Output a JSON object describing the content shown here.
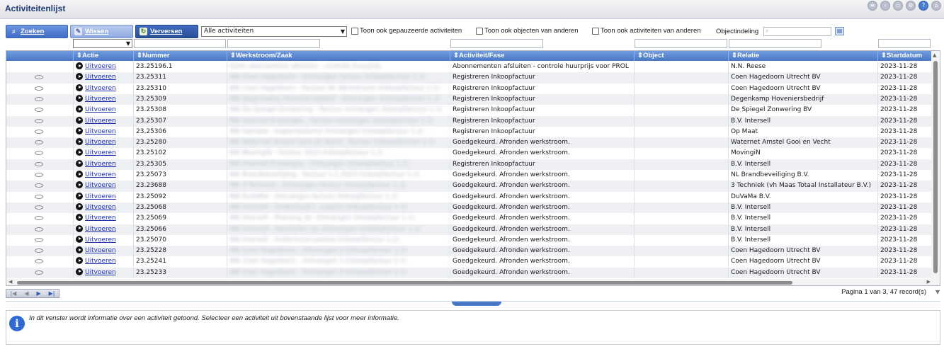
{
  "window": {
    "title": "Activiteitenlijst"
  },
  "toolbar": {
    "search_label": "Zoeken",
    "clear_label": "Wissen",
    "refresh_label": "Verversen",
    "activity_filter_value": "Alle activiteiten",
    "show_paused_label": "Toon ook gepauzeerde activiteiten",
    "show_others_objects_label": "Toon ook objecten van anderen",
    "show_others_activities_label": "Toon ook activiteiten van anderen",
    "object_classification_label": "Objectindeling"
  },
  "columns": [
    "Actie",
    "Nummer",
    "Werkstroom/Zaak",
    "Activiteit/Fase",
    "Object",
    "Relatie",
    "Startdatum"
  ],
  "rows": [
    {
      "action": "Uitvoeren",
      "number": "23.25196.1",
      "workflow": "Geen abonnement afsluiten - controle huurprijs",
      "activity": "Abonnementen afsluiten - controle huurprijs voor PROL",
      "object": "",
      "relation": "N.N. Reese",
      "start": "2023-11-28",
      "eye": false
    },
    {
      "action": "Uitvoeren",
      "number": "23.25311",
      "workflow": "INK Coen Hagedoorn - Ontvangen factuur (Inkoopfactuur 1.1)",
      "activity": "Registreren Inkoopfactuur",
      "object": "",
      "relation": "Coen Hagedoorn Utrecht BV",
      "start": "2023-11-28",
      "eye": true
    },
    {
      "action": "Uitvoeren",
      "number": "23.25310",
      "workflow": "INK Coen Hagedoorn - Factuur de Werkstroom (Inkoopfactuur 1.1)",
      "activity": "Registreren Inkoopfactuur",
      "object": "",
      "relation": "Coen Hagedoorn Utrecht BV",
      "start": "2023-11-28",
      "eye": true
    },
    {
      "action": "Uitvoeren",
      "number": "23.25309",
      "workflow": "INK Degenkamp Hoveniersbedrijf - Ontvangen (Inkoopfactuur 1.1)",
      "activity": "Registreren Inkoopfactuur",
      "object": "",
      "relation": "Degenkamp Hoveniersbedrijf",
      "start": "2023-11-28",
      "eye": true
    },
    {
      "action": "Uitvoeren",
      "number": "23.25308",
      "workflow": "INK De Spiegel Zonwering - Factuur ontvangen (Inkoopfactuur 1.1)",
      "activity": "Registreren Inkoopfactuur",
      "object": "",
      "relation": "De Spiegel Zonwering BV",
      "start": "2023-11-28",
      "eye": true
    },
    {
      "action": "Uitvoeren",
      "number": "23.25307",
      "workflow": "INK Intersell Kruisingen - Factuur ontvangen (Inkoopfactuur 1.1)",
      "activity": "Registreren Inkoopfactuur",
      "object": "",
      "relation": "B.V. Intersell",
      "start": "2023-11-28",
      "eye": true
    },
    {
      "action": "Uitvoeren",
      "number": "23.25306",
      "workflow": "INK Opmaat - Inspectiedienst Ontvangen (Inkoopfactuur 1.1)",
      "activity": "Registreren Inkoopfactuur",
      "object": "",
      "relation": "Op Maat",
      "start": "2023-11-28",
      "eye": true
    },
    {
      "action": "Uitvoeren",
      "number": "23.25280",
      "workflow": "INK Waternet Amstel Gooi en Vecht - Factuur (Inkoopfactuur 1.1)",
      "activity": "Goedgekeurd. Afronden werkstroom.",
      "object": "",
      "relation": "Waternet Amstel Gooi en Vecht",
      "start": "2023-11-28",
      "eye": true
    },
    {
      "action": "Uitvoeren",
      "number": "23.25102",
      "workflow": "INK MovingiN - Factuur 2023 (Inkoopfactuur 1.1)",
      "activity": "Goedgekeurd. Afronden werkstroom.",
      "object": "",
      "relation": "MovingiN",
      "start": "2023-11-28",
      "eye": true
    },
    {
      "action": "Uitvoeren",
      "number": "23.25305",
      "workflow": "INK Intersell Kruisingen - Ontvangen (Inkoopfactuur 1.1)",
      "activity": "Registreren Inkoopfactuur",
      "object": "",
      "relation": "B.V. Intersell",
      "start": "2023-11-28",
      "eye": true
    },
    {
      "action": "Uitvoeren",
      "number": "23.25073",
      "workflow": "INK Brandbeveiliging - Factuur 1.1 2023 (Inkoopfactuur 1.1)",
      "activity": "Goedgekeurd. Afronden werkstroom.",
      "object": "",
      "relation": "NL Brandbeveiliging B.V.",
      "start": "2023-11-28",
      "eye": true
    },
    {
      "action": "Uitvoeren",
      "number": "23.23688",
      "workflow": "INK 3 Techniek - Ontvangen factuur (Inkoopfactuur 1.1)",
      "activity": "Goedgekeurd. Afronden werkstroom.",
      "object": "",
      "relation": "3 Techniek (vh Maas Totaal Installateur B.V.)",
      "start": "2023-11-28",
      "eye": true
    },
    {
      "action": "Uitvoeren",
      "number": "23.25092",
      "workflow": "INK DuVaMa - Ontvangen factuur (Inkoopfactuur 1.1)",
      "activity": "Goedgekeurd. Afronden werkstroom.",
      "object": "",
      "relation": "DuVaMa B.V.",
      "start": "2023-11-28",
      "eye": true
    },
    {
      "action": "Uitvoeren",
      "number": "23.25068",
      "workflow": "INK Intersell - Onderhoud 1. Laatste (Inkoopfactuur 1.1)",
      "activity": "Goedgekeurd. Afronden werkstroom.",
      "object": "",
      "relation": "B.V. Intersell",
      "start": "2023-11-28",
      "eye": true
    },
    {
      "action": "Uitvoeren",
      "number": "23.25069",
      "workflow": "INK Intersell - Planning 2e. Ontvangen (Inkoopfactuur 1.1)",
      "activity": "Goedgekeurd. Afronden werkstroom.",
      "object": "",
      "relation": "B.V. Intersell",
      "start": "2023-11-28",
      "eye": true
    },
    {
      "action": "Uitvoeren",
      "number": "23.25066",
      "workflow": "INK Intersell - Aansluiten 3e. Ontvangen (Inkoopfactuur 1.1)",
      "activity": "Goedgekeurd. Afronden werkstroom.",
      "object": "",
      "relation": "B.V. Intersell",
      "start": "2023-11-28",
      "eye": true
    },
    {
      "action": "Uitvoeren",
      "number": "23.25070",
      "workflow": "INK Intersell - Onderhoud Laatste (Inkoopfactuur 1.1)",
      "activity": "Goedgekeurd. Afronden werkstroom.",
      "object": "",
      "relation": "B.V. Intersell",
      "start": "2023-11-28",
      "eye": true
    },
    {
      "action": "Uitvoeren",
      "number": "23.25228",
      "workflow": "INK Coen Hagedoorn - Ontvangen 2 (Inkoopfactuur 1.1)",
      "activity": "Goedgekeurd. Afronden werkstroom.",
      "object": "",
      "relation": "Coen Hagedoorn Utrecht BV",
      "start": "2023-11-28",
      "eye": true
    },
    {
      "action": "Uitvoeren",
      "number": "23.25241",
      "workflow": "INK Coen Hagedoorn - Ontvangen 3 (Inkoopfactuur 1.1)",
      "activity": "Goedgekeurd. Afronden werkstroom.",
      "object": "",
      "relation": "Coen Hagedoorn Utrecht BV",
      "start": "2023-11-28",
      "eye": true
    },
    {
      "action": "Uitvoeren",
      "number": "23.25233",
      "workflow": "INK Coen Hagedoorn - Ontvangen 4 (Inkoopfactuur 1.1)",
      "activity": "Goedgekeurd. Afronden werkstroom.",
      "object": "",
      "relation": "Coen Hagedoorn Utrecht BV",
      "start": "2023-11-28",
      "eye": true
    }
  ],
  "pagination": {
    "info": "Pagina 1 van 3, 47 record(s)"
  },
  "info_pane": {
    "text": "In dit venster wordt informatie over een activiteit getoond. Selecteer een activiteit uit bovenstaande lijst voor meer informatie."
  }
}
